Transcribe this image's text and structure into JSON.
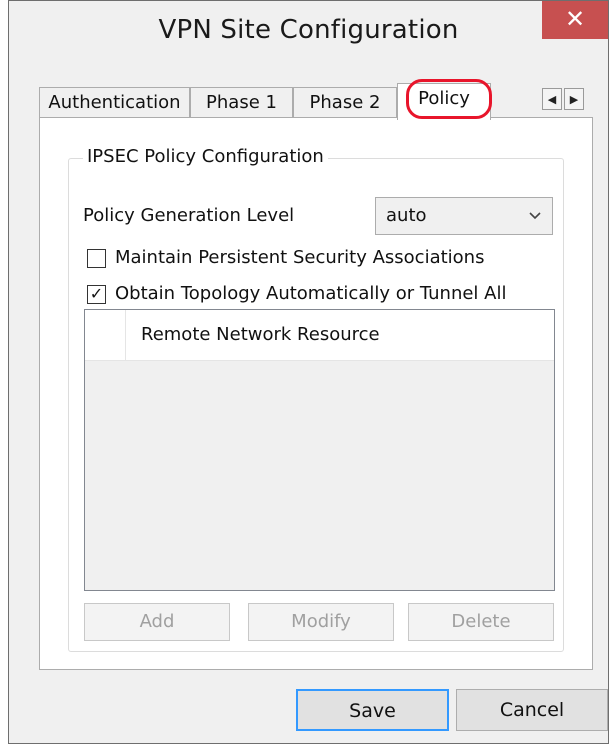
{
  "window": {
    "title": "VPN Site Configuration",
    "close_label": "✕"
  },
  "tabs": [
    {
      "label": "Authentication",
      "active": false
    },
    {
      "label": "Phase 1",
      "active": false
    },
    {
      "label": "Phase 2",
      "active": false
    },
    {
      "label": "Policy",
      "active": true
    }
  ],
  "tab_scroll": {
    "left": "◀",
    "right": "▶"
  },
  "policy": {
    "group_title": "IPSEC Policy Configuration",
    "generation_level_label": "Policy Generation Level",
    "generation_level_value": "auto",
    "maintain_sa_label": "Maintain Persistent Security Associations",
    "maintain_sa_checked": false,
    "obtain_topology_label": "Obtain Topology Automatically or Tunnel All",
    "obtain_topology_checked": true,
    "obtain_topology_mark": "✓",
    "list_column": "Remote Network Resource",
    "add_label": "Add",
    "modify_label": "Modify",
    "delete_label": "Delete"
  },
  "footer": {
    "save_label": "Save",
    "cancel_label": "Cancel"
  },
  "colors": {
    "close_bg": "#c75050",
    "highlight": "#e8152b",
    "default_button_border": "#3399ff"
  }
}
